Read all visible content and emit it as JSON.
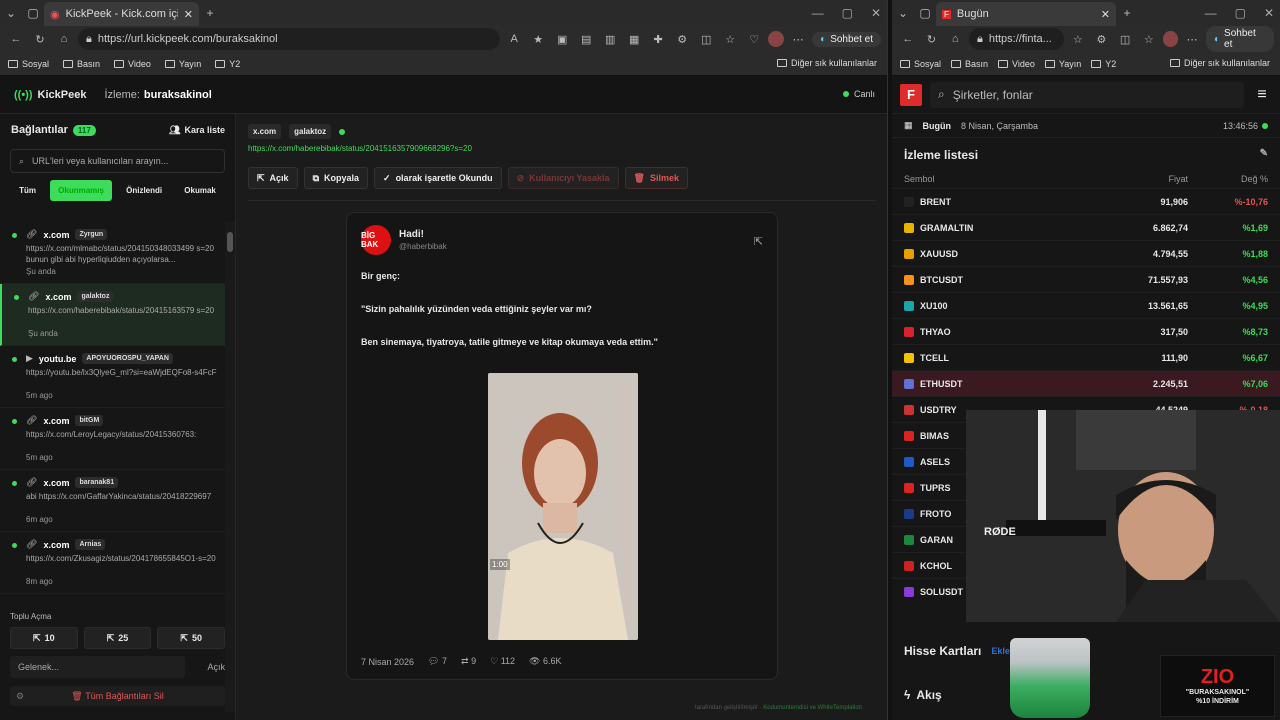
{
  "left_browser": {
    "tab_title": "KickPeek - Kick.com için Gerçe",
    "url": "https://url.kickpeek.com/buraksakinol",
    "chat_label": "Sohbet et",
    "bookmarks": [
      "Sosyal",
      "Basın",
      "Video",
      "Yayın",
      "Y2"
    ],
    "bookmarks_other": "Diğer sık kullanılanlar"
  },
  "kickpeek": {
    "logo": "KickPeek",
    "watching_label": "İzleme:",
    "channel": "buraksakinol",
    "status": "Canlı",
    "links_title": "Bağlantılar",
    "links_count": "117",
    "blacklist": "Kara liste",
    "search_placeholder": "URL'leri veya kullanıcıları arayın...",
    "filters": [
      "Tüm",
      "Okunmamış",
      "Önizlendi",
      "Okumak"
    ],
    "items": [
      {
        "domain": "x.com",
        "user": "Zyrgun",
        "url": "https://x.com/mlmabc/status/204150348033499 s=20 bunun gibi abi hyperliqiudden açıyolarsa...",
        "time": "Şu anda"
      },
      {
        "domain": "x.com",
        "user": "galaktoz",
        "url": "https://x.com/haberebibak/status/20415163579 s=20",
        "time": "Şu anda"
      },
      {
        "domain": "youtu.be",
        "user": "APOYUOROSPU_YAPAN",
        "url": "https://youtu.be/lx3QlyeG_ml?si=eaWjdEQFo8-s4FcF",
        "time": "5m ago"
      },
      {
        "domain": "x.com",
        "user": "bitGM",
        "url": "https://x.com/LeroyLegacy/status/20415360763:",
        "time": "5m ago"
      },
      {
        "domain": "x.com",
        "user": "baranak81",
        "url": "abi https://x.com/GaffarYakinca/status/20418229697",
        "time": "6m ago"
      },
      {
        "domain": "x.com",
        "user": "Arnias",
        "url": "https://x.com/Zkusagiz/status/204178655845O1-s=20",
        "time": "8m ago"
      }
    ],
    "bulk_label": "Toplu Açma",
    "bulk_buttons": [
      "10",
      "25",
      "50"
    ],
    "incoming_placeholder": "Gelenek...",
    "incoming_action": "Açık",
    "delete_all": "Tüm Bağlantıları Sil",
    "main": {
      "domain": "x.com",
      "user": "galaktoz",
      "url": "https://x.com/haberebibak/status/2041516357909668296?s=20",
      "actions": [
        "Açık",
        "Kopyala",
        "olarak işaretle Okundu",
        "Kullanıcıyı Yasakla",
        "Silmek"
      ]
    },
    "tweet": {
      "avatar_text": "BİG BAK",
      "name": "Hadi!",
      "handle": "@haberbibak",
      "lines": [
        "Bir genç:",
        "\"Sizin pahalılık yüzünden veda ettiğiniz şeyler var mı?",
        "Ben sinemaya, tiyatroya, tatile gitmeye ve kitap okumaya veda ettim.\""
      ],
      "date": "7 Nisan 2026",
      "replies": "7",
      "retweets": "9",
      "likes": "112",
      "views": "6.6K",
      "video_time": "1:00"
    },
    "footer_prefix": "tarafından geliştirilmiştir",
    "footer_link": "Kodumuntemdisi ve WhiteTemplation"
  },
  "right_browser": {
    "tab_title": "Bugün",
    "url": "https://finta...",
    "chat_label": "Sohbet et",
    "bookmarks": [
      "Sosyal",
      "Basın",
      "Video",
      "Yayın",
      "Y2"
    ],
    "bookmarks_other": "Diğer sık kullanılanlar"
  },
  "finance": {
    "logo": "F",
    "search_placeholder": "Şirketler, fonlar",
    "today": "Bugün",
    "date": "8 Nisan, Çarşamba",
    "time": "13:46:56",
    "watchlist_title": "İzleme listesi",
    "col_symbol": "Sembol",
    "col_price": "Fiyat",
    "col_change": "Değ %",
    "rows": [
      {
        "sym": "BRENT",
        "price": "91,906",
        "chg": "%-10,76",
        "dir": "down",
        "color": "#222"
      },
      {
        "sym": "GRAMALTIN",
        "price": "6.862,74",
        "chg": "%1,69",
        "dir": "up",
        "color": "#e8b400"
      },
      {
        "sym": "XAUUSD",
        "price": "4.794,55",
        "chg": "%1,88",
        "dir": "up",
        "color": "#e8a000"
      },
      {
        "sym": "BTCUSDT",
        "price": "71.557,93",
        "chg": "%4,56",
        "dir": "up",
        "color": "#f7931a"
      },
      {
        "sym": "XU100",
        "price": "13.561,65",
        "chg": "%4,95",
        "dir": "up",
        "color": "#1aa7a7"
      },
      {
        "sym": "THYAO",
        "price": "317,50",
        "chg": "%8,73",
        "dir": "up",
        "color": "#d8232a"
      },
      {
        "sym": "TCELL",
        "price": "111,90",
        "chg": "%6,67",
        "dir": "up",
        "color": "#f5c400"
      },
      {
        "sym": "ETHUSDT",
        "price": "2.245,51",
        "chg": "%7,06",
        "dir": "up",
        "color": "#6271d8"
      },
      {
        "sym": "USDTRY",
        "price": "44,5249",
        "chg": "%-0,18",
        "dir": "down",
        "color": "#c33"
      },
      {
        "sym": "BIMAS",
        "price": "",
        "chg": "",
        "dir": "",
        "color": "#d22"
      },
      {
        "sym": "ASELS",
        "price": "",
        "chg": "",
        "dir": "",
        "color": "#1f5bc7"
      },
      {
        "sym": "TUPRS",
        "price": "",
        "chg": "",
        "dir": "",
        "color": "#d22"
      },
      {
        "sym": "FROTO",
        "price": "",
        "chg": "",
        "dir": "",
        "color": "#1a3a8a"
      },
      {
        "sym": "GARAN",
        "price": "",
        "chg": "",
        "dir": "",
        "color": "#1a8a3a"
      },
      {
        "sym": "KCHOL",
        "price": "",
        "chg": "",
        "dir": "",
        "color": "#c22"
      },
      {
        "sym": "SOLUSDT",
        "price": "",
        "chg": "",
        "dir": "",
        "color": "#8a3ad8"
      }
    ],
    "cards_title": "Hisse Kartları",
    "cards_add": "Ekle",
    "flow": "Akış"
  },
  "overlays": {
    "mic_brand": "RØDE",
    "promo_logo": "ZIO",
    "promo_line1": "\"BURAKSAKINOL\"",
    "promo_line2": "%10 İNDİRİM"
  }
}
